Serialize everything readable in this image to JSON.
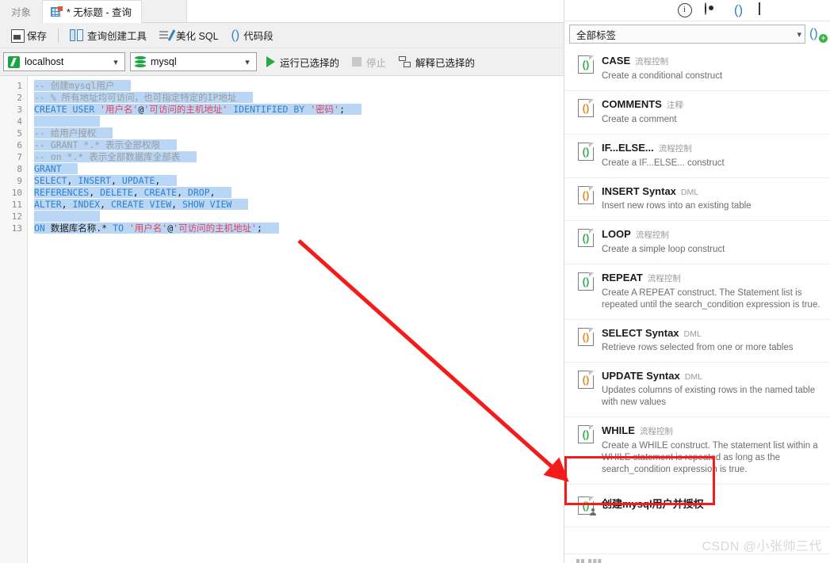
{
  "window": {
    "tabs": [
      {
        "label": "对象",
        "active": false,
        "icon": "none"
      },
      {
        "label": "* 无标题 - 查询",
        "active": true,
        "icon": "query-tab-icon"
      }
    ]
  },
  "toolbar": {
    "save_label": "保存",
    "query_builder_label": "查询创建工具",
    "beautify_label": "美化 SQL",
    "snippet_label": "代码段"
  },
  "connection_bar": {
    "connection": "localhost",
    "database": "mysql",
    "run_selected_label": "运行已选择的",
    "stop_label": "停止",
    "explain_selected_label": "解释已选择的"
  },
  "editor": {
    "line_numbers": [
      "1",
      "2",
      "3",
      "4",
      "5",
      "6",
      "7",
      "8",
      "9",
      "10",
      "11",
      "12",
      "13"
    ],
    "lines": [
      {
        "n": "1",
        "text": "-- 创建mysql用户"
      },
      {
        "n": "2",
        "text": "-- % 所有地址均可访问，也可指定特定的IP地址"
      },
      {
        "n": "3",
        "text": "CREATE USER '用户名'@'可访问的主机地址' IDENTIFIED BY '密码';"
      },
      {
        "n": "4",
        "text": ""
      },
      {
        "n": "5",
        "text": "-- 给用户授权"
      },
      {
        "n": "6",
        "text": "-- GRANT *.* 表示全部权限"
      },
      {
        "n": "7",
        "text": "-- on *.* 表示全部数据库全部表"
      },
      {
        "n": "8",
        "text": "GRANT"
      },
      {
        "n": "9",
        "text": "SELECT, INSERT, UPDATE,"
      },
      {
        "n": "10",
        "text": "REFERENCES, DELETE, CREATE, DROP,"
      },
      {
        "n": "11",
        "text": "ALTER, INDEX, CREATE VIEW, SHOW VIEW"
      },
      {
        "n": "12",
        "text": ""
      },
      {
        "n": "13",
        "text": "ON 数据库名称.* TO '用户名'@'可访问的主机地址';"
      }
    ]
  },
  "snippet_panel": {
    "header_icons": [
      "info-icon",
      "eye-icon",
      "parentheses-icon",
      "table-icon"
    ],
    "filter_value": "全部标签",
    "add_label": "",
    "items": [
      {
        "title": "CASE",
        "category": "流程控制",
        "desc": "Create a conditional construct",
        "icon_color": "green"
      },
      {
        "title": "COMMENTS",
        "category": "注释",
        "desc": "Create a comment",
        "icon_color": "orange"
      },
      {
        "title": "IF...ELSE...",
        "category": "流程控制",
        "desc": "Create a IF...ELSE... construct",
        "icon_color": "green"
      },
      {
        "title": "INSERT Syntax",
        "category": "DML",
        "desc": "Insert new rows into an existing table",
        "icon_color": "orange"
      },
      {
        "title": "LOOP",
        "category": "流程控制",
        "desc": "Create a simple loop construct",
        "icon_color": "green"
      },
      {
        "title": "REPEAT",
        "category": "流程控制",
        "desc": "Create A REPEAT construct. The Statement list is repeated until the search_condition expression is true.",
        "icon_color": "green"
      },
      {
        "title": "SELECT Syntax",
        "category": "DML",
        "desc": "Retrieve rows selected from one or more tables",
        "icon_color": "orange"
      },
      {
        "title": "UPDATE Syntax",
        "category": "DML",
        "desc": "Updates columns of existing rows in the named table with new values",
        "icon_color": "orange"
      },
      {
        "title": "WHILE",
        "category": "流程控制",
        "desc": "Create a WHILE construct. The statement list within a WHILE statement is repeated as long as the search_condition expression is true.",
        "icon_color": "green"
      },
      {
        "title": "创建mysql用户并授权",
        "category": "",
        "desc": "",
        "icon_color": "green"
      }
    ]
  },
  "annotation": {
    "highlight_color": "#f51b1b",
    "arrow_color": "#f51b1b"
  },
  "watermark": {
    "text": "CSDN @小张帅三代"
  },
  "colors": {
    "selection": "#b9d7f5",
    "keyword": "#2f7fd0",
    "string": "#e8415a",
    "comment": "#9a9a9a",
    "accent_green": "#28a745"
  }
}
